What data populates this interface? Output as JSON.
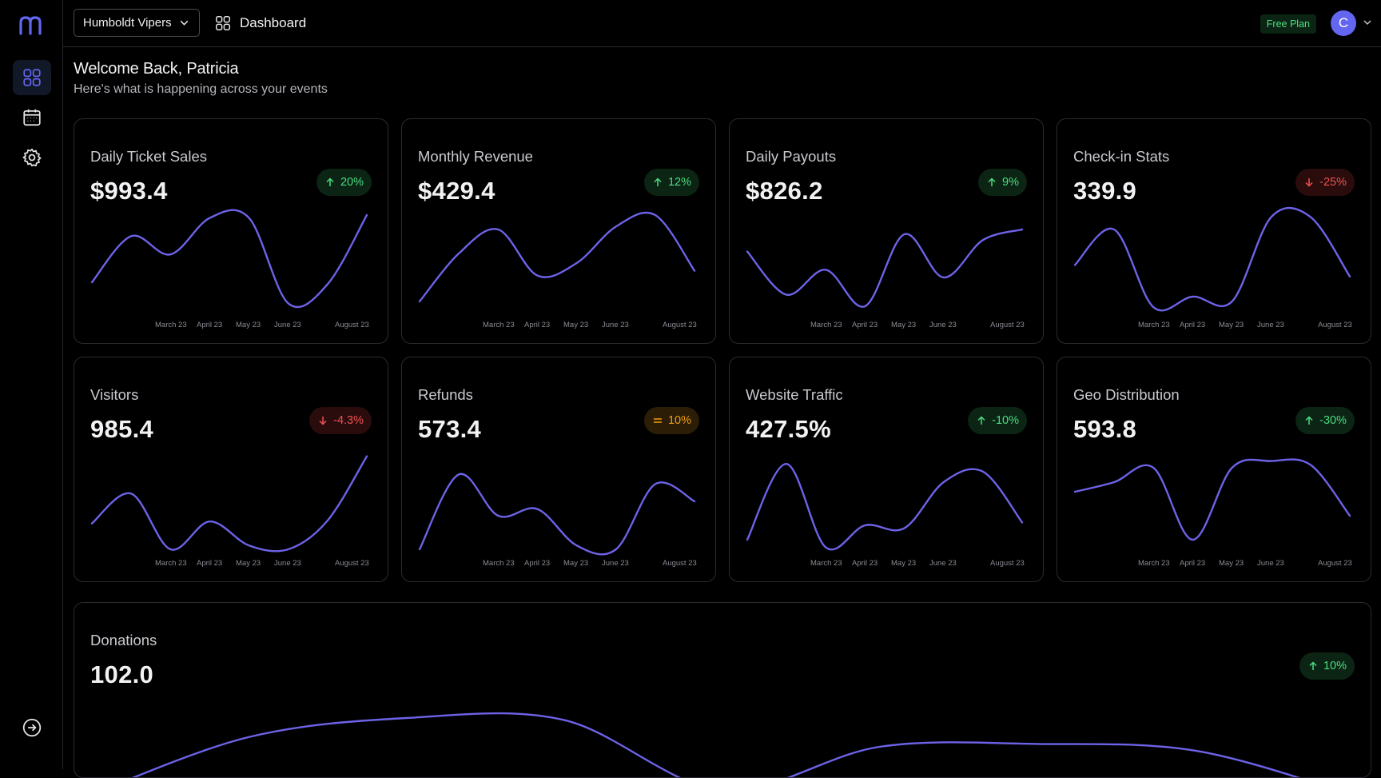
{
  "app": {
    "logo": "m"
  },
  "sidebar": {
    "items": [
      {
        "name": "dashboard",
        "icon": "grid-icon",
        "active": true
      },
      {
        "name": "events",
        "icon": "calendar-icon",
        "active": false
      },
      {
        "name": "settings",
        "icon": "gear-icon",
        "active": false
      }
    ],
    "bottom_icon": "arrow-right-circle-icon"
  },
  "topbar": {
    "org_select": "Humboldt Vipers",
    "breadcrumb": "Dashboard",
    "plan_badge": "Free Plan",
    "avatar_initial": "C"
  },
  "welcome": {
    "title": "Welcome Back, Patricia",
    "subtitle": "Here's what is happening across your events"
  },
  "axis_labels": [
    "March 23",
    "April 23",
    "May 23",
    "June 23",
    "August 23"
  ],
  "colors": {
    "line": "#6d63e8",
    "up": "#4ade80",
    "down": "#f05252",
    "flat": "#f59e0b",
    "accent": "#6366f1"
  },
  "cards": [
    {
      "title": "Daily Ticket Sales",
      "value": "$993.4",
      "change": "20%",
      "trend": "up",
      "series": [
        0.3,
        0.78,
        0.59,
        0.97,
        0.97,
        0.08,
        0.28,
        1.0
      ]
    },
    {
      "title": "Monthly Revenue",
      "value": "$429.4",
      "change": "12%",
      "trend": "up",
      "series": [
        0.1,
        0.6,
        0.85,
        0.37,
        0.5,
        0.88,
        1.0,
        0.42
      ]
    },
    {
      "title": "Daily Payouts",
      "value": "$826.2",
      "change": "9%",
      "trend": "up",
      "series": [
        0.62,
        0.17,
        0.43,
        0.05,
        0.8,
        0.35,
        0.74,
        0.85
      ]
    },
    {
      "title": "Check-in Stats",
      "value": "339.9",
      "change": "-25%",
      "trend": "down",
      "series": [
        0.48,
        0.85,
        0.04,
        0.15,
        0.1,
        0.98,
        0.98,
        0.36
      ]
    },
    {
      "title": "Visitors",
      "value": "985.4",
      "change": "-4.3%",
      "trend": "down",
      "series": [
        0.27,
        0.58,
        0.0,
        0.29,
        0.04,
        0.0,
        0.3,
        0.97
      ]
    },
    {
      "title": "Refunds",
      "value": "573.4",
      "change": "10%",
      "trend": "flat",
      "series": [
        0.0,
        0.78,
        0.35,
        0.42,
        0.04,
        0.0,
        0.68,
        0.5
      ]
    },
    {
      "title": "Website Traffic",
      "value": "427.5%",
      "change": "-10%",
      "trend": "up",
      "series": [
        0.1,
        0.89,
        0.02,
        0.25,
        0.22,
        0.7,
        0.81,
        0.28
      ]
    },
    {
      "title": "Geo Distribution",
      "value": "593.8",
      "change": "-30%",
      "trend": "up",
      "series": [
        0.6,
        0.7,
        0.85,
        0.1,
        0.85,
        0.92,
        0.88,
        0.35
      ]
    }
  ],
  "donations": {
    "title": "Donations",
    "value": "102.0",
    "change": "10%",
    "trend": "up",
    "series": [
      0.0,
      0.6,
      0.8,
      0.78,
      0.05,
      0.5,
      0.53,
      0.46,
      0.0
    ]
  }
}
